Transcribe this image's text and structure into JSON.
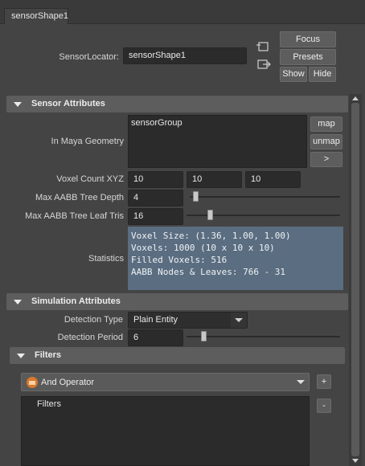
{
  "tab": {
    "label": "sensorShape1"
  },
  "locator": {
    "label": "SensorLocator:",
    "value": "sensorShape1"
  },
  "top_buttons": {
    "focus": "Focus",
    "presets": "Presets",
    "show": "Show",
    "hide": "Hide"
  },
  "sensor_section": {
    "title": "Sensor Attributes",
    "geometry_label": "In Maya Geometry",
    "geometry_value": "sensorGroup",
    "map": "map",
    "unmap": "unmap",
    "more": ">",
    "voxel_label": "Voxel Count XYZ",
    "voxel_x": "10",
    "voxel_y": "10",
    "voxel_z": "10",
    "depth_label": "Max AABB Tree Depth",
    "depth_value": "4",
    "depth_level": 0.02,
    "leaf_label": "Max AABB Tree Leaf Tris",
    "leaf_value": "16",
    "leaf_level": 0.14,
    "stats_label": "Statistics",
    "stats_1": "Voxel Size: (1.36, 1.00, 1.00)",
    "stats_2": "Voxels: 1000 (10 x 10 x 10)",
    "stats_3": "Filled Voxels: 516",
    "stats_4": "AABB Nodes & Leaves: 766 - 31"
  },
  "simulation_section": {
    "title": "Simulation Attributes",
    "type_label": "Detection Type",
    "type_value": "Plain Entity",
    "period_label": "Detection Period",
    "period_value": "6",
    "period_level": 0.1
  },
  "filters_section": {
    "title": "Filters",
    "operator": "And Operator",
    "add": "+",
    "remove": "-",
    "tree_item": "Filters"
  }
}
